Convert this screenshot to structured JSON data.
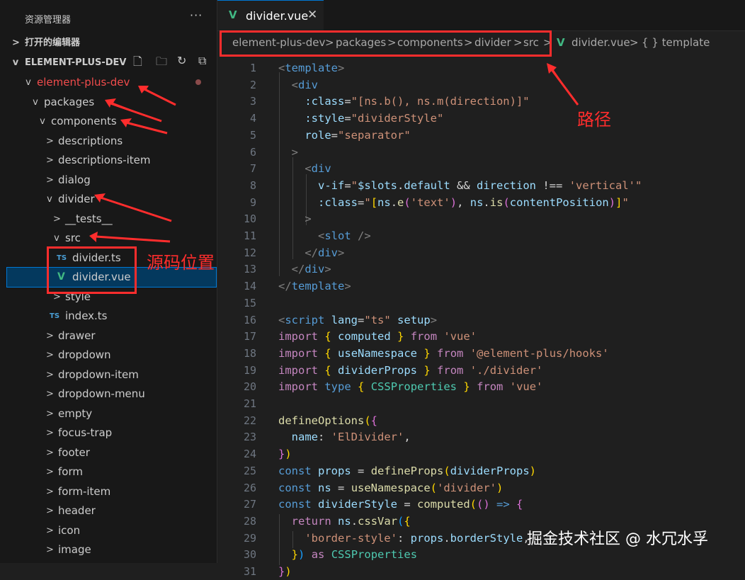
{
  "sidebar": {
    "title": "资源管理器",
    "more": "···",
    "open_editors": "打开的编辑器",
    "workspace": "ELEMENT-PLUS-DEV",
    "tree": [
      {
        "label": "element-plus-dev",
        "depth": 1,
        "chev": "v",
        "modified": true
      },
      {
        "label": "packages",
        "depth": 2,
        "chev": "v"
      },
      {
        "label": "components",
        "depth": 3,
        "chev": "v"
      },
      {
        "label": "descriptions",
        "depth": 4,
        "chev": ">"
      },
      {
        "label": "descriptions-item",
        "depth": 4,
        "chev": ">"
      },
      {
        "label": "dialog",
        "depth": 4,
        "chev": ">"
      },
      {
        "label": "divider",
        "depth": 4,
        "chev": "v"
      },
      {
        "label": "__tests__",
        "depth": 5,
        "chev": ">"
      },
      {
        "label": "src",
        "depth": 5,
        "chev": "v"
      },
      {
        "label": "divider.ts",
        "depth": 6,
        "icon": "TS"
      },
      {
        "label": "divider.vue",
        "depth": 6,
        "icon": "vue",
        "selected": true
      },
      {
        "label": "style",
        "depth": 5,
        "chev": ">"
      },
      {
        "label": "index.ts",
        "depth": 5,
        "icon": "TS"
      },
      {
        "label": "drawer",
        "depth": 4,
        "chev": ">"
      },
      {
        "label": "dropdown",
        "depth": 4,
        "chev": ">"
      },
      {
        "label": "dropdown-item",
        "depth": 4,
        "chev": ">"
      },
      {
        "label": "dropdown-menu",
        "depth": 4,
        "chev": ">"
      },
      {
        "label": "empty",
        "depth": 4,
        "chev": ">"
      },
      {
        "label": "focus-trap",
        "depth": 4,
        "chev": ">"
      },
      {
        "label": "footer",
        "depth": 4,
        "chev": ">"
      },
      {
        "label": "form",
        "depth": 4,
        "chev": ">"
      },
      {
        "label": "form-item",
        "depth": 4,
        "chev": ">"
      },
      {
        "label": "header",
        "depth": 4,
        "chev": ">"
      },
      {
        "label": "icon",
        "depth": 4,
        "chev": ">"
      },
      {
        "label": "image",
        "depth": 4,
        "chev": ">"
      }
    ]
  },
  "tab": {
    "label": "divider.vue",
    "close": "✕"
  },
  "breadcrumb": [
    "element-plus-dev",
    "packages",
    "components",
    "divider",
    "src",
    "divider.vue",
    "{ } template"
  ],
  "annotations": {
    "path": "路径",
    "source": "源码位置"
  },
  "watermark": "掘金技术社区 @ 水冗水孚",
  "code_lines": [
    [
      [
        "tag",
        "<"
      ],
      [
        "tn",
        "template"
      ],
      [
        "tag",
        ">"
      ]
    ],
    [
      [
        "pn",
        "  "
      ],
      [
        "tag",
        "<"
      ],
      [
        "tn",
        "div"
      ]
    ],
    [
      [
        "pn",
        "    "
      ],
      [
        "at",
        ":class"
      ],
      [
        "pn",
        "="
      ],
      [
        "av",
        "\"[ns.b(), ns.m(direction)]\""
      ]
    ],
    [
      [
        "pn",
        "    "
      ],
      [
        "at",
        ":style"
      ],
      [
        "pn",
        "="
      ],
      [
        "av",
        "\"dividerStyle\""
      ]
    ],
    [
      [
        "pn",
        "    "
      ],
      [
        "at",
        "role"
      ],
      [
        "pn",
        "="
      ],
      [
        "av",
        "\"separator\""
      ]
    ],
    [
      [
        "pn",
        "  "
      ],
      [
        "tag",
        ">"
      ]
    ],
    [
      [
        "pn",
        "    "
      ],
      [
        "tag",
        "<"
      ],
      [
        "tn",
        "div"
      ]
    ],
    [
      [
        "pn",
        "      "
      ],
      [
        "at",
        "v-if"
      ],
      [
        "pn",
        "="
      ],
      [
        "av",
        "\""
      ],
      [
        "va",
        "$slots"
      ],
      [
        "pn",
        "."
      ],
      [
        "va",
        "default"
      ],
      [
        "pn",
        " && "
      ],
      [
        "va",
        "direction"
      ],
      [
        "pn",
        " !== "
      ],
      [
        "st",
        "'vertical'"
      ],
      [
        "av",
        "\""
      ]
    ],
    [
      [
        "pn",
        "      "
      ],
      [
        "at",
        ":class"
      ],
      [
        "pn",
        "="
      ],
      [
        "av",
        "\""
      ],
      [
        "br",
        "["
      ],
      [
        "va",
        "ns"
      ],
      [
        "pn",
        "."
      ],
      [
        "fn",
        "e"
      ],
      [
        "br2",
        "("
      ],
      [
        "st",
        "'text'"
      ],
      [
        "br2",
        ")"
      ],
      [
        "pn",
        ", "
      ],
      [
        "va",
        "ns"
      ],
      [
        "pn",
        "."
      ],
      [
        "fn",
        "is"
      ],
      [
        "br2",
        "("
      ],
      [
        "va",
        "contentPosition"
      ],
      [
        "br2",
        ")"
      ],
      [
        "br",
        "]"
      ],
      [
        "av",
        "\""
      ]
    ],
    [
      [
        "pn",
        "    "
      ],
      [
        "tag",
        ">"
      ]
    ],
    [
      [
        "pn",
        "      "
      ],
      [
        "tag",
        "<"
      ],
      [
        "tn",
        "slot"
      ],
      [
        "tag",
        " />"
      ]
    ],
    [
      [
        "pn",
        "    "
      ],
      [
        "tag",
        "</"
      ],
      [
        "tn",
        "div"
      ],
      [
        "tag",
        ">"
      ]
    ],
    [
      [
        "pn",
        "  "
      ],
      [
        "tag",
        "</"
      ],
      [
        "tn",
        "div"
      ],
      [
        "tag",
        ">"
      ]
    ],
    [
      [
        "tag",
        "</"
      ],
      [
        "tn",
        "template"
      ],
      [
        "tag",
        ">"
      ]
    ],
    [
      [
        "pn",
        ""
      ]
    ],
    [
      [
        "tag",
        "<"
      ],
      [
        "tn",
        "script"
      ],
      [
        "pn",
        " "
      ],
      [
        "at",
        "lang"
      ],
      [
        "pn",
        "="
      ],
      [
        "av",
        "\"ts\""
      ],
      [
        "pn",
        " "
      ],
      [
        "at",
        "setup"
      ],
      [
        "tag",
        ">"
      ]
    ],
    [
      [
        "kw2",
        "import"
      ],
      [
        "pn",
        " "
      ],
      [
        "br",
        "{"
      ],
      [
        "pn",
        " "
      ],
      [
        "va",
        "computed"
      ],
      [
        "pn",
        " "
      ],
      [
        "br",
        "}"
      ],
      [
        "pn",
        " "
      ],
      [
        "kw2",
        "from"
      ],
      [
        "pn",
        " "
      ],
      [
        "st",
        "'vue'"
      ]
    ],
    [
      [
        "kw2",
        "import"
      ],
      [
        "pn",
        " "
      ],
      [
        "br",
        "{"
      ],
      [
        "pn",
        " "
      ],
      [
        "va",
        "useNamespace"
      ],
      [
        "pn",
        " "
      ],
      [
        "br",
        "}"
      ],
      [
        "pn",
        " "
      ],
      [
        "kw2",
        "from"
      ],
      [
        "pn",
        " "
      ],
      [
        "st",
        "'@element-plus/hooks'"
      ]
    ],
    [
      [
        "kw2",
        "import"
      ],
      [
        "pn",
        " "
      ],
      [
        "br",
        "{"
      ],
      [
        "pn",
        " "
      ],
      [
        "va",
        "dividerProps"
      ],
      [
        "pn",
        " "
      ],
      [
        "br",
        "}"
      ],
      [
        "pn",
        " "
      ],
      [
        "kw2",
        "from"
      ],
      [
        "pn",
        " "
      ],
      [
        "st",
        "'./divider'"
      ]
    ],
    [
      [
        "kw2",
        "import"
      ],
      [
        "pn",
        " "
      ],
      [
        "kw",
        "type"
      ],
      [
        "pn",
        " "
      ],
      [
        "br",
        "{"
      ],
      [
        "pn",
        " "
      ],
      [
        "ty",
        "CSSProperties"
      ],
      [
        "pn",
        " "
      ],
      [
        "br",
        "}"
      ],
      [
        "pn",
        " "
      ],
      [
        "kw2",
        "from"
      ],
      [
        "pn",
        " "
      ],
      [
        "st",
        "'vue'"
      ]
    ],
    [
      [
        "pn",
        ""
      ]
    ],
    [
      [
        "fn",
        "defineOptions"
      ],
      [
        "br",
        "("
      ],
      [
        "br2",
        "{"
      ]
    ],
    [
      [
        "pn",
        "  "
      ],
      [
        "va",
        "name"
      ],
      [
        "pn",
        ": "
      ],
      [
        "st",
        "'ElDivider'"
      ],
      [
        "pn",
        ","
      ]
    ],
    [
      [
        "br2",
        "}"
      ],
      [
        "br",
        ")"
      ]
    ],
    [
      [
        "kw",
        "const"
      ],
      [
        "pn",
        " "
      ],
      [
        "va",
        "props"
      ],
      [
        "pn",
        " = "
      ],
      [
        "fn",
        "defineProps"
      ],
      [
        "br",
        "("
      ],
      [
        "va",
        "dividerProps"
      ],
      [
        "br",
        ")"
      ]
    ],
    [
      [
        "kw",
        "const"
      ],
      [
        "pn",
        " "
      ],
      [
        "va",
        "ns"
      ],
      [
        "pn",
        " = "
      ],
      [
        "fn",
        "useNamespace"
      ],
      [
        "br",
        "("
      ],
      [
        "st",
        "'divider'"
      ],
      [
        "br",
        ")"
      ]
    ],
    [
      [
        "kw",
        "const"
      ],
      [
        "pn",
        " "
      ],
      [
        "va",
        "dividerStyle"
      ],
      [
        "pn",
        " = "
      ],
      [
        "fn",
        "computed"
      ],
      [
        "br",
        "("
      ],
      [
        "br2",
        "()"
      ],
      [
        "pn",
        " "
      ],
      [
        "kw",
        "=>"
      ],
      [
        "pn",
        " "
      ],
      [
        "br2",
        "{"
      ]
    ],
    [
      [
        "pn",
        "  "
      ],
      [
        "kw2",
        "return"
      ],
      [
        "pn",
        " "
      ],
      [
        "va",
        "ns"
      ],
      [
        "pn",
        "."
      ],
      [
        "fn",
        "cssVar"
      ],
      [
        "br3",
        "("
      ],
      [
        "br",
        "{"
      ]
    ],
    [
      [
        "pn",
        "    "
      ],
      [
        "st",
        "'border-style'"
      ],
      [
        "pn",
        ": "
      ],
      [
        "va",
        "props"
      ],
      [
        "pn",
        "."
      ],
      [
        "va",
        "borderStyle"
      ],
      [
        "pn",
        ","
      ]
    ],
    [
      [
        "pn",
        "  "
      ],
      [
        "br",
        "}"
      ],
      [
        "br3",
        ")"
      ],
      [
        "pn",
        " "
      ],
      [
        "kw2",
        "as"
      ],
      [
        "pn",
        " "
      ],
      [
        "ty",
        "CSSProperties"
      ]
    ],
    [
      [
        "br2",
        "}"
      ],
      [
        "br",
        ")"
      ]
    ]
  ]
}
